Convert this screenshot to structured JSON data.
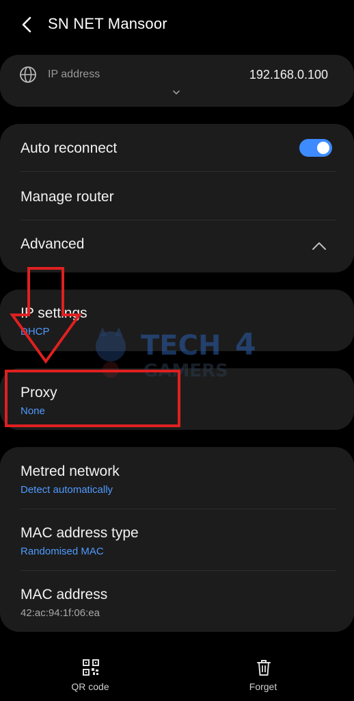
{
  "header": {
    "title": "SN NET Mansoor",
    "back_icon": "chevron-left-icon"
  },
  "ip_card": {
    "label": "IP address",
    "value": "192.168.0.100",
    "icon": "globe-icon"
  },
  "settings_card": {
    "auto_reconnect": {
      "label": "Auto reconnect",
      "enabled": true
    },
    "manage_router": {
      "label": "Manage router"
    },
    "advanced": {
      "label": "Advanced",
      "expanded": true
    }
  },
  "ip_settings": {
    "label": "IP settings",
    "value": "DHCP"
  },
  "proxy": {
    "label": "Proxy",
    "value": "None"
  },
  "network_card": {
    "metred_network": {
      "label": "Metred network",
      "value": "Detect automatically"
    },
    "mac_address_type": {
      "label": "MAC address type",
      "value": "Randomised MAC"
    },
    "mac_address": {
      "label": "MAC address",
      "value": "42:ac:94:1f:06:ea"
    }
  },
  "bottom_bar": {
    "qr_code": {
      "label": "QR code",
      "icon": "qr-code-icon"
    },
    "forget": {
      "label": "Forget",
      "icon": "trash-icon"
    }
  },
  "watermark": {
    "text_line1": "TECH",
    "text_digit": "4",
    "text_line2": "GAMERS"
  },
  "colors": {
    "background": "#000000",
    "card": "#1c1c1c",
    "accent": "#4f9bff",
    "toggle": "#3e8bff",
    "annotation": "#e02020"
  }
}
